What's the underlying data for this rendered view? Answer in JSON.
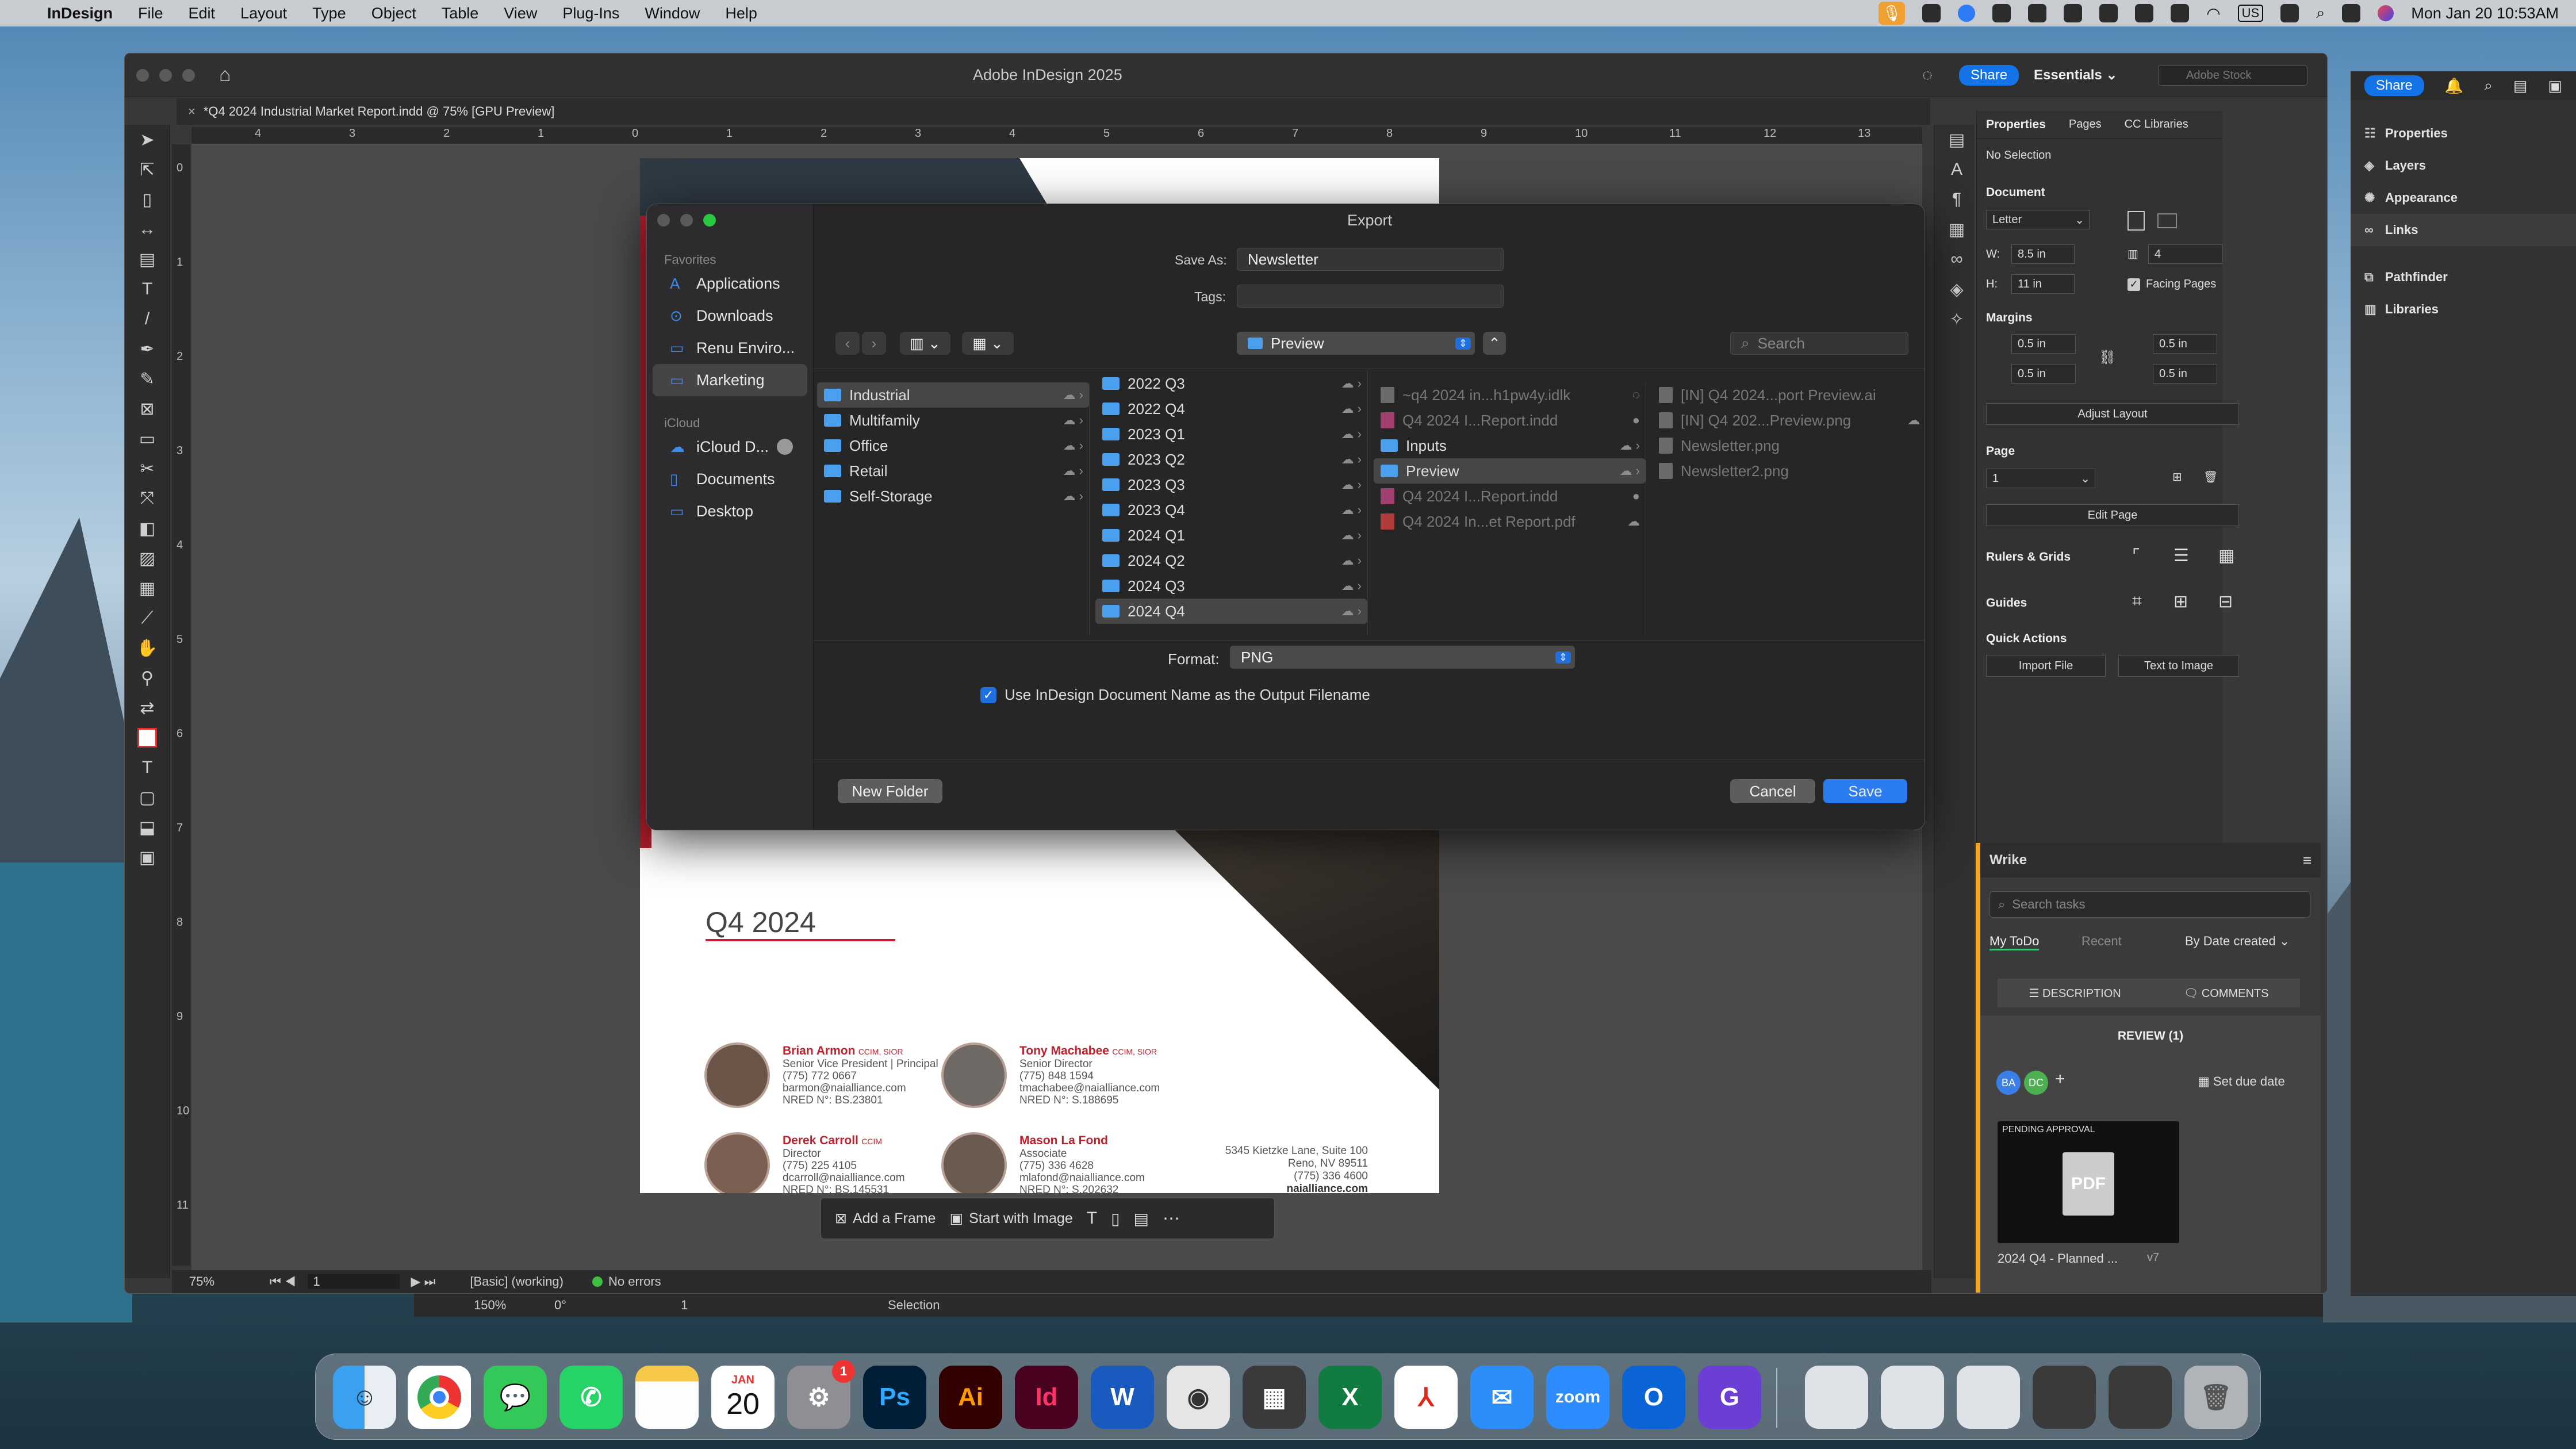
{
  "menubar": {
    "app": "InDesign",
    "items": [
      "File",
      "Edit",
      "Layout",
      "Type",
      "Object",
      "Table",
      "View",
      "Plug-Ins",
      "Window",
      "Help"
    ],
    "datetime": "Mon Jan 20  10:53AM",
    "input_source": "US"
  },
  "window": {
    "title": "Adobe InDesign 2025",
    "share": "Share",
    "workspace": "Essentials",
    "search_placeholder": "Adobe Stock",
    "doc_tab": "*Q4 2024 Industrial Market Report.indd @ 75% [GPU Preview]",
    "ruler_h": [
      "4",
      "3",
      "2",
      "1",
      "0",
      "1",
      "2",
      "3",
      "4",
      "5",
      "6",
      "7",
      "8",
      "9",
      "10",
      "11",
      "12",
      "13"
    ],
    "ruler_v": [
      "0",
      "1",
      "2",
      "3",
      "4",
      "5",
      "6",
      "7",
      "8",
      "9",
      "10",
      "11"
    ]
  },
  "statusbar": {
    "zoom": "75%",
    "page": "1",
    "style": "[Basic] (working)",
    "errors": "No errors"
  },
  "statusbar2": {
    "zoom2": "150%",
    "angle": "0°",
    "page2": "1",
    "selection": "Selection"
  },
  "document": {
    "quarter": "Q4 2024",
    "contacts": [
      {
        "name": "Brian Armon",
        "cred": "CCIM, SIOR",
        "title": "Senior Vice President | Principal",
        "phone": "(775) 772 0667",
        "email": "barmon@naialliance.com",
        "license": "NRED N°: BS.23801"
      },
      {
        "name": "Tony Machabee",
        "cred": "CCIM, SIOR",
        "title": "Senior Director",
        "phone": "(775) 848 1594",
        "email": "tmachabee@naialliance.com",
        "license": "NRED N°: S.188695"
      },
      {
        "name": "Derek Carroll",
        "cred": "CCIM",
        "title": "Director",
        "phone": "(775) 225 4105",
        "email": "dcarroll@naialliance.com",
        "license": "NRED N°: BS.145531"
      },
      {
        "name": "Mason La Fond",
        "cred": "",
        "title": "Associate",
        "phone": "(775) 336 4628",
        "email": "mlafond@naialliance.com",
        "license": "NRED N°: S.202632"
      }
    ],
    "address": [
      "5345 Kietzke Lane, Suite 100",
      "Reno, NV 89511",
      "(775) 336 4600",
      "naialliance.com"
    ]
  },
  "frame_toolbar": {
    "add_frame": "Add a Frame",
    "start_image": "Start with Image"
  },
  "dialog": {
    "title": "Export",
    "save_as_label": "Save As:",
    "save_as_value": "Newsletter",
    "tags_label": "Tags:",
    "location": "Preview",
    "search_placeholder": "Search",
    "sidebar": {
      "favorites_header": "Favorites",
      "favorites": [
        "Applications",
        "Downloads",
        "Renu Enviro...",
        "Marketing"
      ],
      "icloud_header": "iCloud",
      "icloud": [
        "iCloud D...",
        "Documents",
        "Desktop"
      ]
    },
    "col1": [
      "Industrial",
      "Multifamily",
      "Office",
      "Retail",
      "Self-Storage"
    ],
    "col2": [
      "2022 Q3",
      "2022 Q4",
      "2023 Q1",
      "2023 Q2",
      "2023 Q3",
      "2023 Q4",
      "2024 Q1",
      "2024 Q2",
      "2024 Q3",
      "2024 Q4"
    ],
    "col3": [
      "~q4 2024 in...h1pw4y.idlk",
      "Q4 2024 I...Report.indd",
      "Inputs",
      "Preview",
      "Q4 2024 I...Report.indd",
      "Q4 2024 In...et Report.pdf"
    ],
    "col4": [
      "[IN] Q4 2024...port Preview.ai",
      "[IN] Q4 202...Preview.png",
      "Newsletter.png",
      "Newsletter2.png"
    ],
    "format_label": "Format:",
    "format_value": "PNG",
    "checkbox_label": "Use InDesign Document Name as the Output Filename",
    "new_folder": "New Folder",
    "cancel": "Cancel",
    "save": "Save"
  },
  "properties": {
    "tabs": [
      "Properties",
      "Pages",
      "CC Libraries"
    ],
    "no_selection": "No Selection",
    "document_label": "Document",
    "preset": "Letter",
    "w_label": "W:",
    "w": "8.5 in",
    "h_label": "H:",
    "h": "11 in",
    "pages": "4",
    "facing": "Facing Pages",
    "margins_label": "Margins",
    "m_top": "0.5 in",
    "m_bottom": "0.5 in",
    "m_left": "0.5 in",
    "m_right": "0.5 in",
    "adjust_layout": "Adjust Layout",
    "page_label": "Page",
    "page_value": "1",
    "edit_page": "Edit Page",
    "rulers_label": "Rulers & Grids",
    "guides_label": "Guides",
    "quick_actions": "Quick Actions",
    "import_file": "Import File",
    "text_to_image": "Text to Image"
  },
  "right_panels": {
    "share": "Share",
    "items": [
      "Properties",
      "Layers",
      "Appearance",
      "Links",
      "Pathfinder",
      "Libraries"
    ]
  },
  "wrike": {
    "title": "Wrike",
    "search_placeholder": "Search tasks",
    "tab1": "My ToDo",
    "tab2": "Recent",
    "sort": "By Date created",
    "description": "DESCRIPTION",
    "comments": "COMMENTS",
    "review": "REVIEW (1)",
    "avatar1": "BA",
    "avatar2": "DC",
    "due": "Set due date",
    "pending": "PENDING APPROVAL",
    "file_type": "PDF",
    "task_name": "2024 Q4 - Planned ...",
    "version": "v7"
  },
  "dock": {
    "calendar_month": "JAN",
    "calendar_day": "20",
    "badge": "1"
  }
}
